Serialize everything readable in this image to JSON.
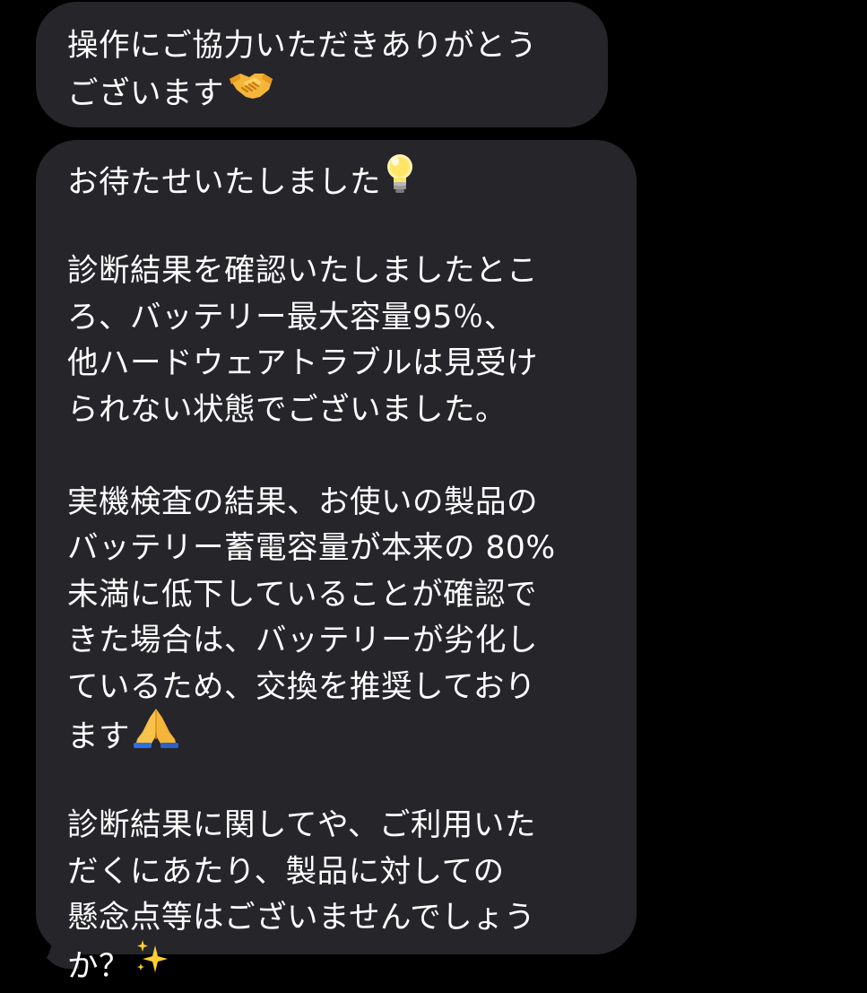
{
  "conversation": {
    "messages": [
      {
        "sender": "received",
        "lines": [
          "操作にご協力いただきありがとう",
          "ございます"
        ],
        "emoji": [
          "handshake-emoji"
        ]
      },
      {
        "sender": "received",
        "paragraphs": [
          {
            "lines": [
              "お待たせいたしました"
            ],
            "emoji": "lightbulb-emoji"
          },
          {
            "lines": [
              "診断結果を確認いたしましたとこ",
              "ろ、バッテリー最大容量95％、",
              "他ハードウェアトラブルは見受け",
              "られない状態でございました。"
            ]
          },
          {
            "lines": [
              "実機検査の結果、お使いの製品の",
              "バッテリー蓄電容量が本来の 80%",
              "未満に低下していることが確認で",
              "きた場合は、バッテリーが劣化し",
              "ているため、交換を推奨しており",
              "ます"
            ],
            "emoji": "folded-hands-emoji"
          },
          {
            "lines": [
              "診断結果に関してや、ご利用いた",
              "だくにあたり、製品に対しての",
              "懸念点等はございませんでしょう",
              "か？"
            ],
            "emoji": "sparkles-emoji"
          }
        ]
      }
    ],
    "colors": {
      "background": "#000000",
      "bubble": "#26252a",
      "text": "#ffffff"
    }
  }
}
